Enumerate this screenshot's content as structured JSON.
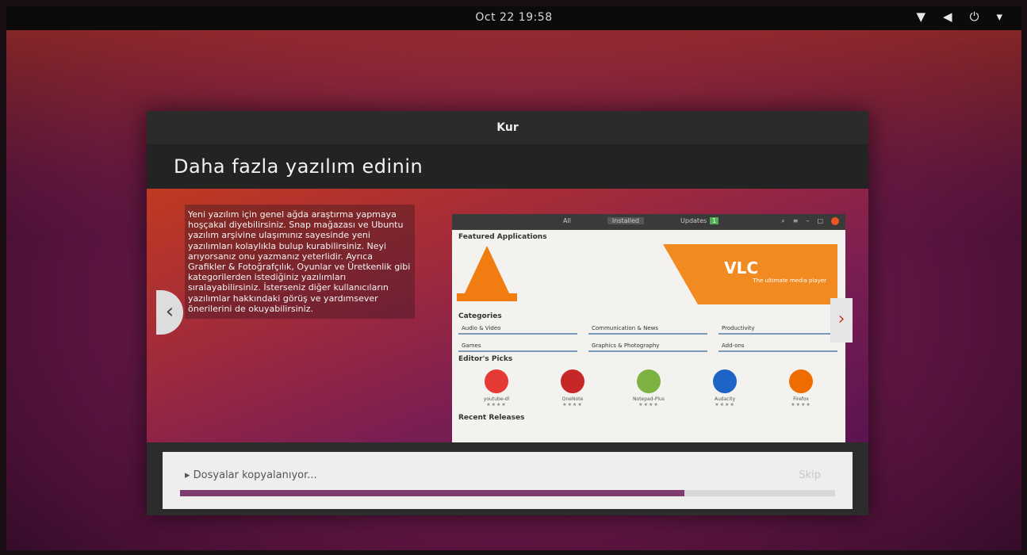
{
  "topbar": {
    "clock": "Oct 22 19:58"
  },
  "window": {
    "title": "Kur",
    "headline": "Daha fazla yazılım edinin",
    "description": "Yeni yazılım için genel ağda araştırma yapmaya hoşçakal diyebilirsiniz. Snap mağazası ve Ubuntu yazılım arşivine ulaşımınız sayesinde yeni yazılımları kolaylıkla bulup kurabilirsiniz. Neyi arıyorsanız onu yazmanız yeterlidir. Ayrıca Grafikler & Fotoğrafçılık, Oyunlar ve Üretkenlik gibi kategorilerden istediğiniz yazılımları sıralayabilirsiniz. İsterseniz diğer kullanıcıların yazılımlar hakkındaki görüş ve yardımsever önerilerini de okuyabilirsiniz."
  },
  "software": {
    "tabs": [
      "All",
      "Installed",
      "Updates"
    ],
    "updates_count": "1",
    "featured_label": "Featured Applications",
    "banner_title": "VLC",
    "banner_subtitle": "The ultimate media player",
    "categories_label": "Categories",
    "categories": [
      "Audio & Video",
      "Communication & News",
      "Productivity",
      "Games",
      "Graphics & Photography",
      "Add-ons"
    ],
    "picks_label": "Editor's Picks",
    "picks": [
      {
        "name": "youtube-dl",
        "color": "#e53935"
      },
      {
        "name": "OneNote",
        "color": "#c62828"
      },
      {
        "name": "Notepad-Plus",
        "color": "#7cb342"
      },
      {
        "name": "Audacity",
        "color": "#1e63c6"
      },
      {
        "name": "Firefox",
        "color": "#ef6c00"
      }
    ],
    "stars": "★★★★",
    "recent_label": "Recent Releases"
  },
  "installer": {
    "status": "Dosyalar kopyalanıyor...",
    "skip_label": "Skip",
    "progress": 0.77
  },
  "colors": {
    "accent": "#e95420",
    "progress": "#7d3b6e"
  }
}
